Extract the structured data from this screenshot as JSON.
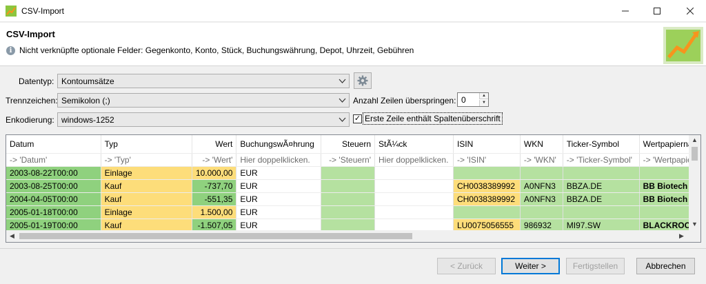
{
  "window": {
    "title": "CSV-Import"
  },
  "header": {
    "title": "CSV-Import",
    "message": "Nicht verknüpfte optionale Felder: Gegenkonto, Konto, Stück, Buchungswährung, Depot, Uhrzeit, Gebühren"
  },
  "form": {
    "datentyp_label": "Datentyp:",
    "datentyp_value": "Kontoumsätze",
    "trennzeichen_label": "Trennzeichen:",
    "trennzeichen_value": "Semikolon (;)",
    "enkodierung_label": "Enkodierung:",
    "enkodierung_value": "windows-1252",
    "skip_label": "Anzahl Zeilen überspringen:",
    "skip_value": "0",
    "header_checkbox_label": "Erste Zeile enthält Spaltenüberschrift",
    "header_checkbox_checked": true
  },
  "table": {
    "columns": [
      "Datum",
      "Typ",
      "Wert",
      "BuchungswÃ¤hrung",
      "Steuern",
      "StÃ¼ck",
      "ISIN",
      "WKN",
      "Ticker-Symbol",
      "Wertpapierna"
    ],
    "mapping": [
      "-> 'Datum'",
      "-> 'Typ'",
      "-> 'Wert'",
      "Hier doppelklicken.",
      "-> 'Steuern'",
      "Hier doppelklicken.",
      "-> 'ISIN'",
      "-> 'WKN'",
      "-> 'Ticker-Symbol'",
      "-> 'Wertpapie"
    ],
    "rows": [
      [
        "2003-08-22T00:00",
        "Einlage",
        "10.000,00",
        "EUR",
        "",
        "",
        "",
        "",
        "",
        ""
      ],
      [
        "2003-08-25T00:00",
        "Kauf",
        "-737,70",
        "EUR",
        "",
        "",
        "CH0038389992",
        "A0NFN3",
        "BBZA.DE",
        "BB Biotech"
      ],
      [
        "2004-04-05T00:00",
        "Kauf",
        "-551,35",
        "EUR",
        "",
        "",
        "CH0038389992",
        "A0NFN3",
        "BBZA.DE",
        "BB Biotech"
      ],
      [
        "2005-01-18T00:00",
        "Einlage",
        "1.500,00",
        "EUR",
        "",
        "",
        "",
        "",
        "",
        ""
      ],
      [
        "2005-01-19T00:00",
        "Kauf",
        "-1.507,05",
        "EUR",
        "",
        "",
        "LU0075056555",
        "986932",
        "MI97.SW",
        "BLACKROCK"
      ]
    ]
  },
  "buttons": {
    "back": "< Zurück",
    "next": "Weiter >",
    "finish": "Fertigstellen",
    "cancel": "Abbrechen"
  },
  "icons": {
    "app": "chart-wizard-icon",
    "info": "info-icon",
    "gear": "gear-icon"
  }
}
